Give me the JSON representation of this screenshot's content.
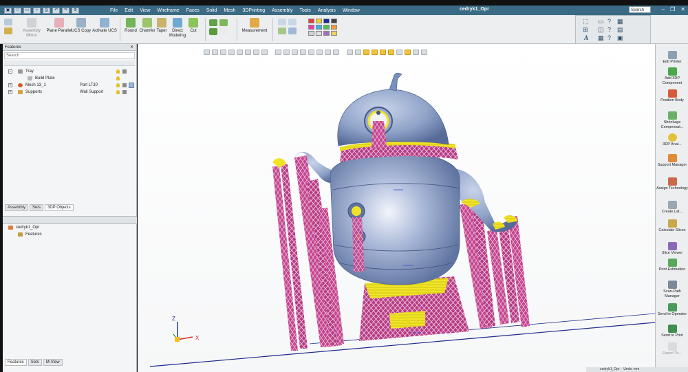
{
  "title_bar": {
    "menu": [
      "File",
      "Edit",
      "View",
      "Wireframe",
      "Faces",
      "Solid",
      "Mesh",
      "3DPrinting",
      "Assembly",
      "Tools",
      "Analysis",
      "Window"
    ],
    "doc_title": "cedryk1_Opr",
    "search_label": "Search"
  },
  "ribbon": {
    "assembly_mirror": "Assembly Mirror",
    "plane_parallel": "Plane Parallel",
    "ucs_copy": "UCS Copy",
    "activate_ucs": "Activate UCS",
    "round": "Round",
    "chamfer": "Chamfer",
    "taper": "Taper",
    "direct_modeling": "Direct Modeling",
    "cut": "Cut",
    "measurement": "Measurement"
  },
  "left_panel": {
    "header": "Features",
    "search_placeholder": "Search",
    "tree": [
      {
        "name": "Tray",
        "type": ""
      },
      {
        "name": "Build Plate",
        "type": ""
      },
      {
        "name": "Mesh 13_1",
        "type": "Part LT30"
      },
      {
        "name": "Supports",
        "type": "Wall Support"
      }
    ],
    "top_tabs": [
      "Assembly",
      "Sets",
      "3DP Objects"
    ],
    "lower_tree": [
      {
        "name": "cedryk1_Opr"
      },
      {
        "name": "Features"
      }
    ],
    "bottom_tabs": [
      "Features",
      "Sets",
      "M-View"
    ]
  },
  "viewport": {
    "axis_z": "Z",
    "axis_x": "X",
    "colors": {
      "body": "#8fa3c8",
      "body_shade": "#5f74a0",
      "support": "#c2468f",
      "contact": "#f1e426",
      "grid_line": "#1c2a8a"
    }
  },
  "right_panel": {
    "items": [
      "Edit Printer",
      "Add 3DP Component",
      "Position Body",
      "Shrinkage Compensat...",
      "3DP Anal...",
      "Support Manager",
      "Assign Technology",
      "Create Lat...",
      "Calculate Slices",
      "Slice Viewer",
      "Print Estimation",
      "Scan-Path Manager",
      "Send to Operator",
      "Send to Print",
      "Export To..."
    ]
  },
  "status_bar": {
    "doc": "cedryk1_Opr",
    "units": "Undo: mm"
  }
}
